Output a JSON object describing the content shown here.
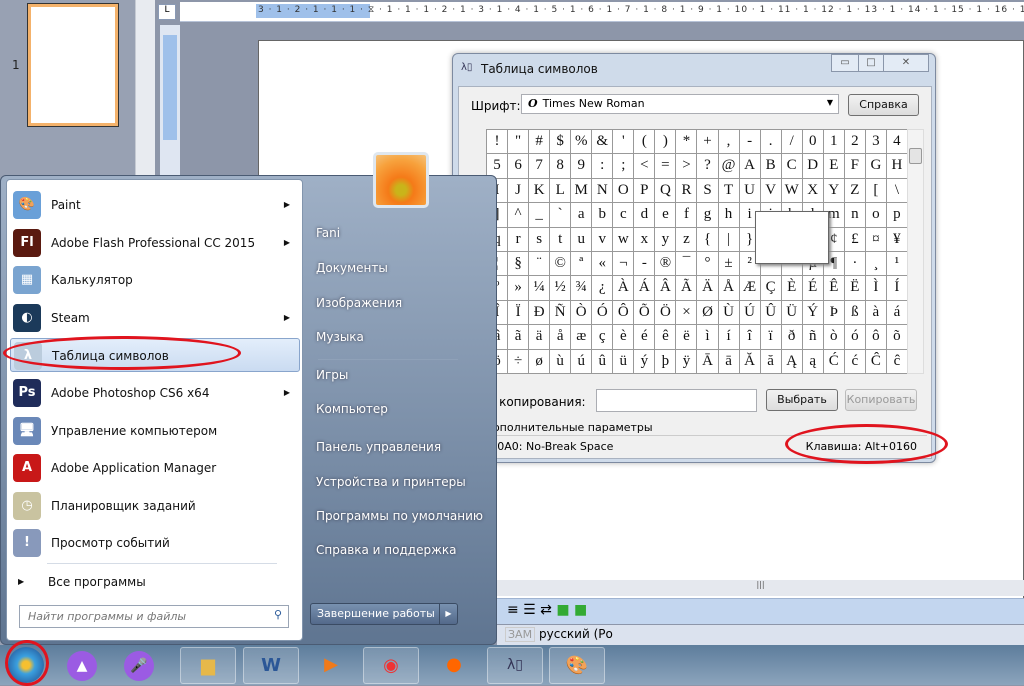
{
  "word": {
    "slide_number": "1",
    "ruler": "3 · 1 · 2 · 1 · 1 · 1 · ⧖ · 1 · 1 · 1 · 2 · 1 · 3 · 1 · 4 · 1 · 5 · 1 · 6 · 1 · 7 · 1 · 8 · 1 · 9 · 1 · 10 · 1 · 11 · 1 · 12 · 1 · 13 · 1 · 14 · 1 · 15 · 1 · 16 · 1 · 17",
    "tab_selector": "L",
    "status": {
      "ovr": "ЗАМ",
      "language": "русский (Ро"
    }
  },
  "charmap": {
    "title": "Таблица символов",
    "font_label": "Шрифт:",
    "font_value": "Times New Roman",
    "help_button": "Справка",
    "rows": [
      [
        "!",
        "\"",
        "#",
        "$",
        "%",
        "&",
        "'",
        "(",
        ")",
        "*",
        "+",
        ",",
        "-",
        ".",
        "/",
        "0",
        "1",
        "2",
        "3",
        "4"
      ],
      [
        "5",
        "6",
        "7",
        "8",
        "9",
        ":",
        ";",
        "<",
        "=",
        ">",
        "?",
        "@",
        "A",
        "B",
        "C",
        "D",
        "E",
        "F",
        "G",
        "H"
      ],
      [
        "I",
        "J",
        "K",
        "L",
        "M",
        "N",
        "O",
        "P",
        "Q",
        "R",
        "S",
        "T",
        "U",
        "V",
        "W",
        "X",
        "Y",
        "Z",
        "[",
        "\\"
      ],
      [
        "]",
        "^",
        "_",
        "`",
        "a",
        "b",
        "c",
        "d",
        "e",
        "f",
        "g",
        "h",
        "i",
        "j",
        "k",
        "l",
        "m",
        "n",
        "o",
        "p"
      ],
      [
        "q",
        "r",
        "s",
        "t",
        "u",
        "v",
        "w",
        "x",
        "y",
        "z",
        "{",
        "|",
        "}",
        "~",
        " ",
        "¡",
        "¢",
        "£",
        "¤",
        "¥"
      ],
      [
        "¦",
        "§",
        "¨",
        "©",
        "ª",
        "«",
        "¬",
        "-",
        "®",
        "¯",
        "°",
        "±",
        "²",
        "³",
        "´",
        "µ",
        "¶",
        "·",
        "¸",
        "¹"
      ],
      [
        "º",
        "»",
        "¼",
        "½",
        "¾",
        "¿",
        "À",
        "Á",
        "Â",
        "Ã",
        "Ä",
        "Å",
        "Æ",
        "Ç",
        "È",
        "É",
        "Ê",
        "Ë",
        "Ì",
        "Í"
      ],
      [
        "Î",
        "Ï",
        "Ð",
        "Ñ",
        "Ò",
        "Ó",
        "Ô",
        "Õ",
        "Ö",
        "×",
        "Ø",
        "Ù",
        "Ú",
        "Û",
        "Ü",
        "Ý",
        "Þ",
        "ß",
        "à",
        "á"
      ],
      [
        "â",
        "ã",
        "ä",
        "å",
        "æ",
        "ç",
        "è",
        "é",
        "ê",
        "ë",
        "ì",
        "í",
        "î",
        "ï",
        "ð",
        "ñ",
        "ò",
        "ó",
        "ô",
        "õ"
      ],
      [
        "ö",
        "÷",
        "ø",
        "ù",
        "ú",
        "û",
        "ü",
        "ý",
        "þ",
        "ÿ",
        "Ā",
        "ā",
        "Ă",
        "ă",
        "Ą",
        "ą",
        "Ć",
        "ć",
        "Ĉ",
        "ĉ"
      ]
    ],
    "copy_label": "Для копирования:",
    "copy_value": "",
    "select_button": "Выбрать",
    "copy_button": "Копировать",
    "advanced_label": "Дополнительные параметры",
    "status_char": "U+00A0: No-Break Space",
    "status_key": "Клавиша: Alt+0160"
  },
  "start_menu": {
    "programs": [
      {
        "label": "Paint",
        "icon": "paint-icon",
        "arrow": true
      },
      {
        "label": "Adobe Flash Professional CC 2015",
        "icon": "flash-icon",
        "arrow": true
      },
      {
        "label": "Калькулятор",
        "icon": "calculator-icon",
        "arrow": false
      },
      {
        "label": "Steam",
        "icon": "steam-icon",
        "arrow": true
      },
      {
        "label": "Таблица символов",
        "icon": "charmap-icon",
        "arrow": false,
        "selected": true
      },
      {
        "label": "Adobe Photoshop CS6 x64",
        "icon": "photoshop-icon",
        "arrow": true
      },
      {
        "label": "Управление компьютером",
        "icon": "computer-management-icon",
        "arrow": false
      },
      {
        "label": "Adobe Application Manager",
        "icon": "adobe-icon",
        "arrow": false
      },
      {
        "label": "Планировщик заданий",
        "icon": "task-scheduler-icon",
        "arrow": false
      },
      {
        "label": "Просмотр событий",
        "icon": "event-viewer-icon",
        "arrow": false
      }
    ],
    "all_programs": "Все программы",
    "search_placeholder": "Найти программы и файлы",
    "right": [
      "Fani",
      "Документы",
      "Изображения",
      "Музыка",
      "Игры",
      "Компьютер",
      "Панель управления",
      "Устройства и принтеры",
      "Программы по умолчанию",
      "Справка и поддержка"
    ],
    "shutdown": "Завершение работы"
  },
  "taskbar": [
    "start",
    "alice",
    "voice-assistant",
    "explorer",
    "word",
    "media-player",
    "chrome",
    "firefox",
    "charmap",
    "paint"
  ],
  "colors": {
    "highlight_ellipse": "#e0141e",
    "accent": "#9b5be3"
  }
}
